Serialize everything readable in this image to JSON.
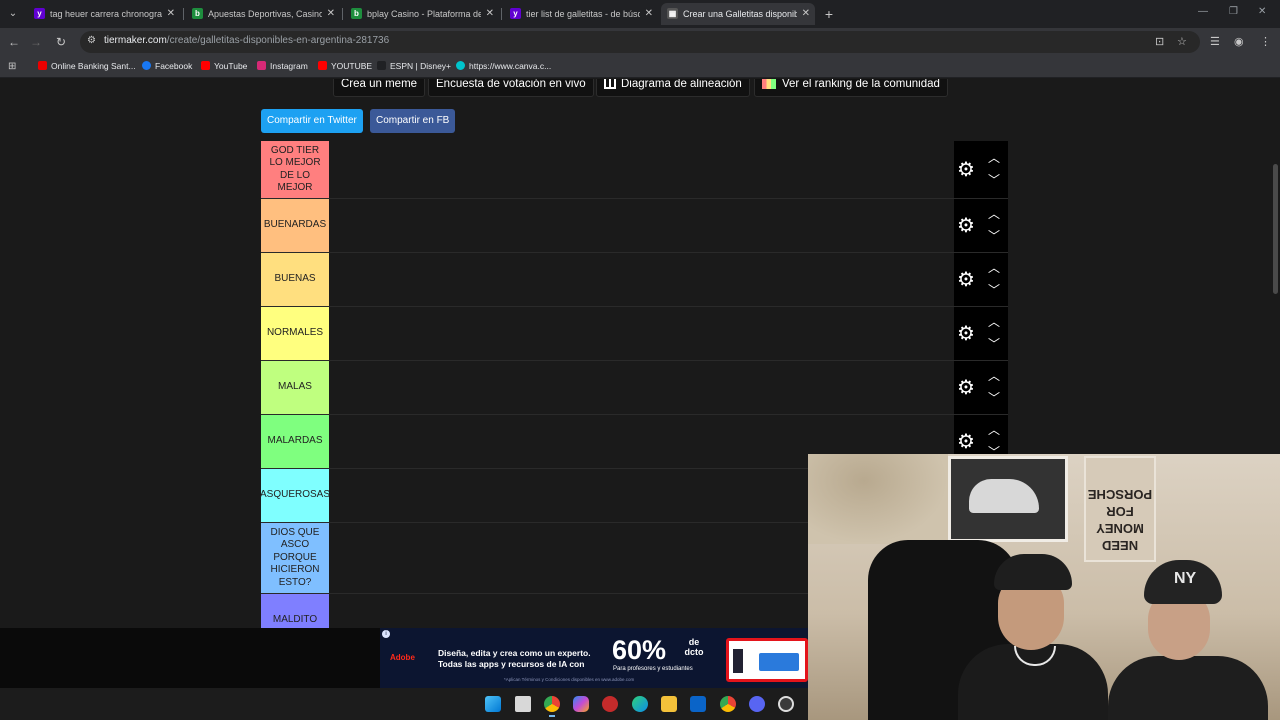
{
  "tabs": [
    {
      "title": "tag heuer carrera chronograph",
      "favicon": "yahoo-icon",
      "color": "#6001d2",
      "active": false
    },
    {
      "title": "Apuestas Deportivas, Casino Online",
      "favicon": "bplay-icon",
      "color": "#1e8e3e",
      "active": false
    },
    {
      "title": "bplay Casino - Plataforma de Casino",
      "favicon": "bplay-icon",
      "color": "#1e8e3e",
      "active": false
    },
    {
      "title": "tier list de galletitas - de búsqueda",
      "favicon": "yahoo-icon",
      "color": "#6001d2",
      "active": false
    },
    {
      "title": "Crear una Galletitas disponibles",
      "favicon": "tiermaker-icon",
      "color": "#555555",
      "active": true
    }
  ],
  "address_bar": {
    "domain": "tiermaker.com",
    "path": "/create/galletitas-disponibles-en-argentina-281736"
  },
  "bookmarks": [
    {
      "label": "Online Banking Sant...",
      "color": "#ec0000"
    },
    {
      "label": "Facebook",
      "color": "#1877f2"
    },
    {
      "label": "YouTube",
      "color": "#ff0000"
    },
    {
      "label": "Instagram",
      "color": "#d62976"
    },
    {
      "label": "YOUTUBE",
      "color": "#ff0000"
    },
    {
      "label": "ESPN | Disney+",
      "color": "#202124"
    },
    {
      "label": "https://www.canva.c...",
      "color": "#00c4cc"
    }
  ],
  "page": {
    "top_buttons": {
      "meme": "Crea un meme",
      "poll": "Encuesta de votación en vivo",
      "alignment": "Diagrama de alineación",
      "ranking": "Ver el ranking de la comunidad"
    },
    "share_twitter": "Compartir en Twitter",
    "share_fb": "Compartir en FB"
  },
  "tiers": [
    {
      "label": "GOD TIER LO MEJOR DE LO MEJOR",
      "color": "#ff7f7f"
    },
    {
      "label": "BUENARDAS",
      "color": "#ffbf7f"
    },
    {
      "label": "BUENAS",
      "color": "#ffdf7f"
    },
    {
      "label": "NORMALES",
      "color": "#ffff7f"
    },
    {
      "label": "MALAS",
      "color": "#bfff7f"
    },
    {
      "label": "MALARDAS",
      "color": "#7fff7f"
    },
    {
      "label": "ASQUEROSAS",
      "color": "#7fffff"
    },
    {
      "label": "DIOS QUE ASCO PORQUE HICIERON ESTO?",
      "color": "#7fbfff"
    },
    {
      "label": "MALDITO",
      "color": "#7f7fff"
    }
  ],
  "ad": {
    "brand": "Adobe",
    "line1": "Diseña, edita y crea como un experto.",
    "line2": "Todas las apps y recursos de IA con",
    "percent": "60%",
    "percent_suffix": "de dcto",
    "audience": "Para profesores y estudiantes",
    "fine_print": "*Aplican Términos y Condiciones disponibles en www.adobe.com"
  },
  "webcam": {
    "poster_text": "NEED MONEY FOR PORSCHE",
    "cap_logo": "NY"
  },
  "taskbar": [
    "windows-icon",
    "task-view-icon",
    "chrome-icon",
    "copilot-icon",
    "app-icon",
    "edge-icon",
    "file-explorer-icon",
    "outlook-icon",
    "chrome-icon",
    "discord-icon",
    "obs-icon"
  ]
}
